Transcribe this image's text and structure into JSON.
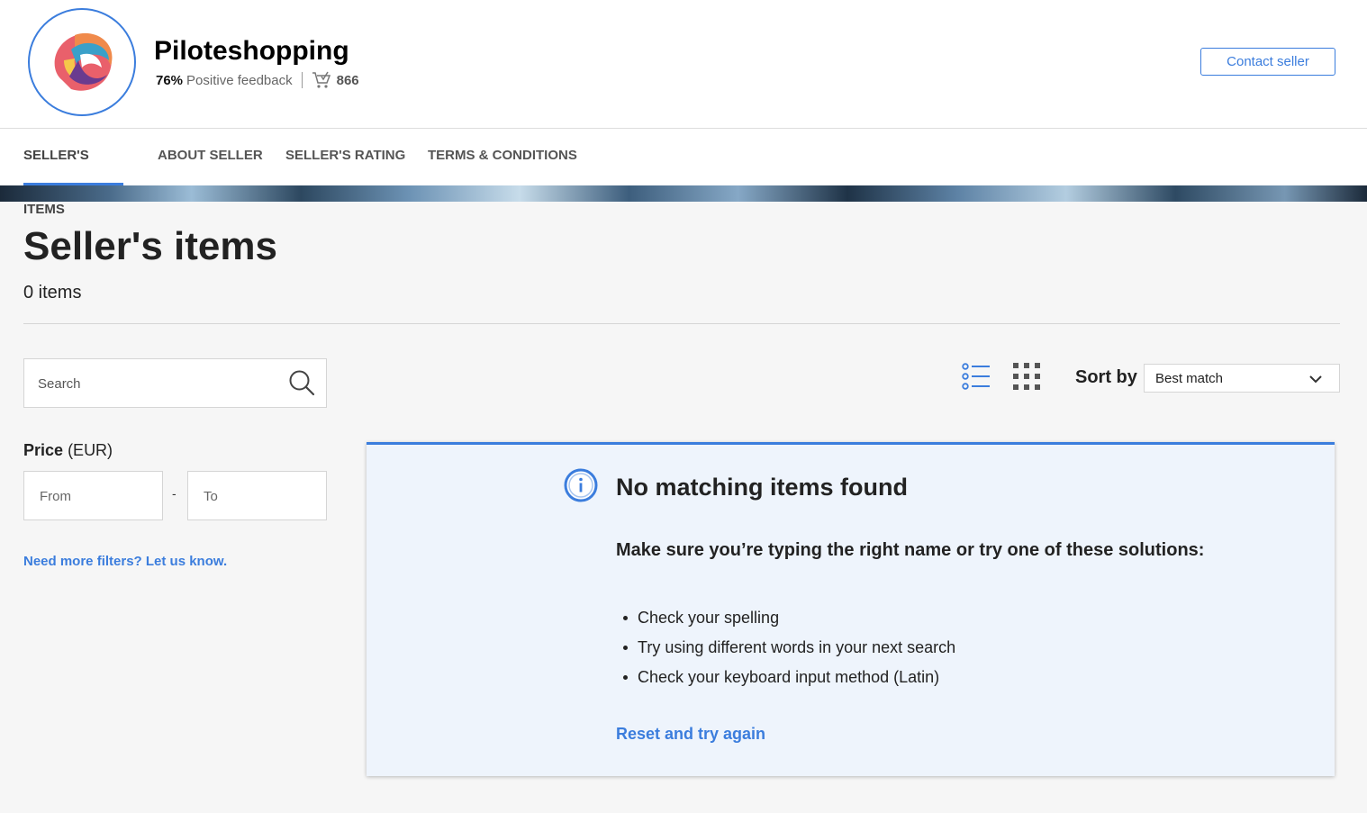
{
  "seller": {
    "name": "Piloteshopping",
    "feedback_percent": "76%",
    "feedback_label": "Positive feedback",
    "sales_count": "866",
    "contact_label": "Contact seller"
  },
  "tabs": [
    {
      "label": "SELLER'S ITEMS",
      "active": true
    },
    {
      "label": "ABOUT SELLER"
    },
    {
      "label": "SELLER'S RATING"
    },
    {
      "label": "TERMS & CONDITIONS"
    }
  ],
  "main": {
    "title": "Seller's items",
    "count": "0 items"
  },
  "filters": {
    "search_placeholder": "Search",
    "price_label": "Price",
    "price_currency": "(EUR)",
    "from_placeholder": "From",
    "dash": "-",
    "to_placeholder": "To",
    "more_filters": "Need more filters? Let us know."
  },
  "toolbar": {
    "sort_label": "Sort by",
    "sort_value": "Best match"
  },
  "empty": {
    "title": "No matching items found",
    "subtitle": "Make sure you’re typing the right name or try one of these solutions:",
    "tips": [
      "Check your spelling",
      "Try using different words in your next search",
      "Check your keyboard input method (Latin)"
    ],
    "reset": "Reset and try again"
  },
  "colors": {
    "accent": "#3b7ddd",
    "panel_bg": "#eef4fc",
    "page_bg": "#f6f6f6"
  },
  "icons": [
    "seller-logo",
    "cart-icon",
    "search-icon",
    "list-view-icon",
    "grid-view-icon",
    "chevron-down-icon",
    "info-icon"
  ]
}
